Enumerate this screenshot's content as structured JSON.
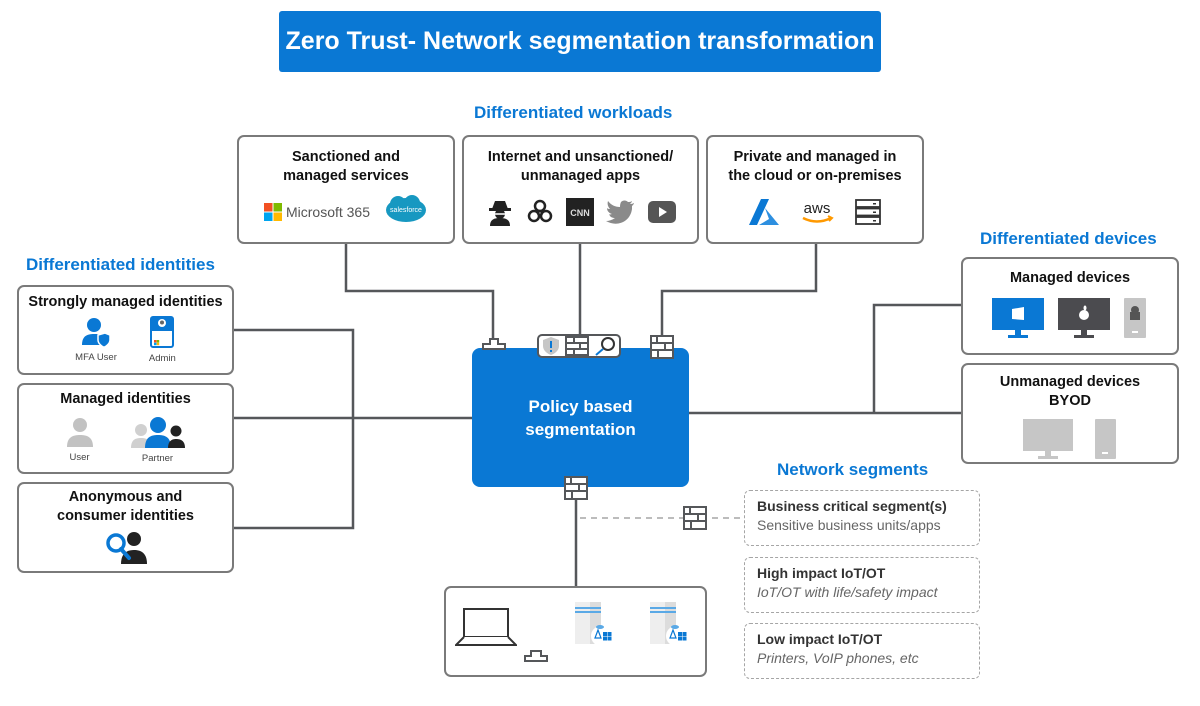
{
  "title": "Zero Trust- Network segmentation transformation",
  "workloads": {
    "heading": "Differentiated workloads",
    "boxes": [
      {
        "title_line1": "Sanctioned and",
        "title_line2": "managed services",
        "icons": [
          "microsoft-365-logo",
          "salesforce-logo"
        ],
        "ms365_label": "Microsoft 365",
        "salesforce_label": "salesforce"
      },
      {
        "title_line1": "Internet and unsanctioned/",
        "title_line2": "unmanaged apps",
        "icons": [
          "hacker-icon",
          "biohazard-icon",
          "cnn-logo",
          "twitter-icon",
          "youtube-icon"
        ],
        "cnn_label": "CNN"
      },
      {
        "title_line1": "Private and managed in",
        "title_line2": "the cloud or on-premises",
        "icons": [
          "azure-logo",
          "aws-logo",
          "server-icon"
        ],
        "aws_label": "aws"
      }
    ]
  },
  "identities": {
    "heading": "Differentiated identities",
    "boxes": [
      {
        "title": "Strongly managed identities",
        "items": [
          {
            "label": "MFA User",
            "icon": "mfa-user-icon"
          },
          {
            "label": "Admin",
            "icon": "admin-badge-icon"
          }
        ]
      },
      {
        "title": "Managed identities",
        "items": [
          {
            "label": "User",
            "icon": "user-icon"
          },
          {
            "label": "Partner",
            "icon": "partner-group-icon"
          }
        ]
      },
      {
        "title_line1": "Anonymous and",
        "title_line2": "consumer identities",
        "items": [
          {
            "label": "",
            "icon": "anonymous-search-user-icon"
          }
        ]
      }
    ]
  },
  "devices": {
    "heading": "Differentiated devices",
    "boxes": [
      {
        "title": "Managed devices",
        "icons": [
          "windows-monitor-icon",
          "mac-monitor-icon",
          "android-phone-icon"
        ]
      },
      {
        "title_line1": "Unmanaged devices",
        "title_line2": "BYOD",
        "icons": [
          "monitor-icon",
          "phone-icon"
        ]
      }
    ]
  },
  "policy": {
    "line1": "Policy based",
    "line2": "segmentation"
  },
  "segments": {
    "heading": "Network segments",
    "items": [
      {
        "title": "Business critical segment(s)",
        "desc": "Sensitive business units/apps",
        "italic": false
      },
      {
        "title": "High impact IoT/OT",
        "desc": "IoT/OT with life/safety impact",
        "italic": true
      },
      {
        "title": "Low impact IoT/OT",
        "desc": "Printers, VoIP phones, etc",
        "italic": true
      }
    ]
  },
  "colors": {
    "accent": "#0a78d4",
    "line": "#55575a",
    "border": "#7a7a7a",
    "dashed": "#a5a5a5"
  }
}
